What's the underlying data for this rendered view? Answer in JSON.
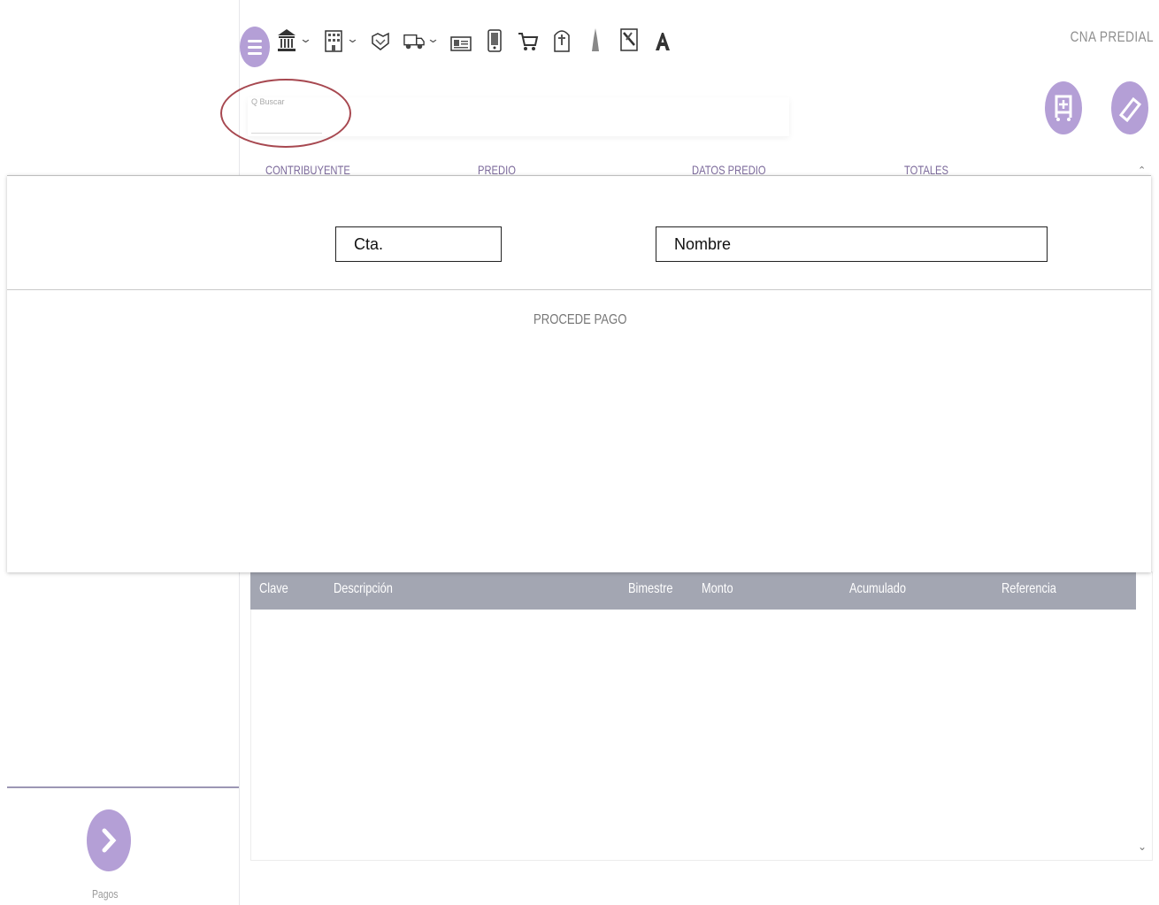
{
  "header": {
    "app_title": "CNA PREDIAL",
    "toolbar_icons": [
      {
        "name": "bank-icon",
        "has_dropdown": true
      },
      {
        "name": "building-icon",
        "has_dropdown": true
      },
      {
        "name": "handshake-icon",
        "has_dropdown": false
      },
      {
        "name": "truck-icon",
        "has_dropdown": true
      },
      {
        "name": "id-card-icon",
        "has_dropdown": false
      },
      {
        "name": "phone-icon",
        "has_dropdown": false
      },
      {
        "name": "cart-icon",
        "has_dropdown": false
      },
      {
        "name": "tombstone-icon",
        "has_dropdown": false
      },
      {
        "name": "tower-icon",
        "has_dropdown": false
      },
      {
        "name": "document-icon",
        "has_dropdown": false
      },
      {
        "name": "letter-a-icon",
        "has_dropdown": false
      }
    ]
  },
  "search": {
    "placeholder": "Q Buscar"
  },
  "actions": {
    "add_to_cart_icon": "cart-plus-icon",
    "eraser_icon": "eraser-icon"
  },
  "tabs": [
    {
      "label": "CONTRIBUYENTE"
    },
    {
      "label": "PREDIO"
    },
    {
      "label": "DATOS PREDIO"
    },
    {
      "label": "TOTALES"
    }
  ],
  "overlay": {
    "cta_label": "Cta.",
    "nombre_label": "Nombre",
    "status_text": "PROCEDE PAGO"
  },
  "table": {
    "columns": [
      "Clave",
      "Descripción",
      "Bimestre",
      "Monto",
      "Acumulado",
      "Referencia"
    ],
    "rows": []
  },
  "sidebar": {
    "pagos_label": "Pagos"
  },
  "colors": {
    "accent": "#b49fd6",
    "table_header": "#a3a6b2",
    "annotation": "#a74850"
  }
}
